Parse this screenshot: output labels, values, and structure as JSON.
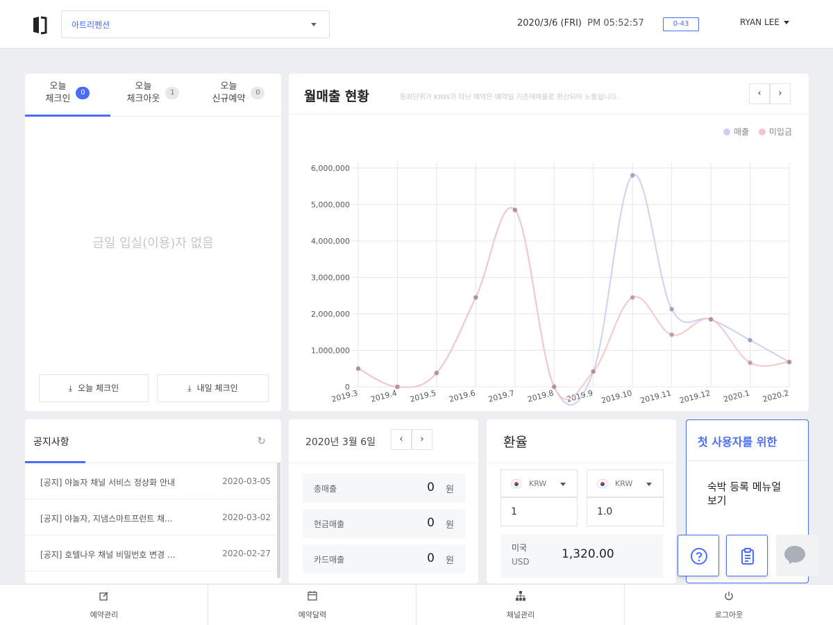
{
  "header": {
    "property_selected": "아트리펜션",
    "date": "2020/3/6 (FRI)",
    "time": "PM 05:52:57",
    "timer": "0-43",
    "user": "RYAN LEE"
  },
  "checkin": {
    "tabs": [
      {
        "line1": "오늘",
        "line2": "체크인",
        "count": "0"
      },
      {
        "line1": "오늘",
        "line2": "체크아웃",
        "count": "1"
      },
      {
        "line1": "오늘",
        "line2": "신규예약",
        "count": "0"
      }
    ],
    "empty_message": "금일 입실(이용)자 없음",
    "today_checkin_btn": "오늘 체크인",
    "tomorrow_checkin_btn": "내일 체크인"
  },
  "chart_card": {
    "title": "월매출 현황",
    "subtitle": "통화단위가 KRW가 아닌 예약은 예약일 기준매매율로 환산되어 노출됩니다.",
    "prev": "‹",
    "next": "›"
  },
  "chart_data": {
    "type": "line",
    "categories": [
      "2019.3",
      "2019.4",
      "2019.5",
      "2019.6",
      "2019.7",
      "2019.8",
      "2019.9",
      "2019.10",
      "2019.11",
      "2019.12",
      "2020.1",
      "2020.2"
    ],
    "series": [
      {
        "name": "매출",
        "color": "#c9cff5",
        "values": [
          500000,
          0,
          380000,
          2450000,
          4850000,
          0,
          420000,
          5800000,
          2130000,
          1850000,
          1280000,
          680000
        ]
      },
      {
        "name": "미입금",
        "color": "#f5c4c8",
        "values": [
          500000,
          0,
          380000,
          2450000,
          4850000,
          0,
          420000,
          2450000,
          1430000,
          1850000,
          660000,
          680000
        ]
      }
    ],
    "yticks": [
      "0",
      "1,000,000",
      "2,000,000",
      "3,000,000",
      "4,000,000",
      "5,000,000",
      "6,000,000"
    ],
    "ylim": [
      0,
      6000000
    ],
    "legend": "top-right"
  },
  "notice": {
    "title": "공지사항",
    "refresh_icon": "refresh-icon",
    "items": [
      {
        "title": "[공지] 야놀자 채널 서비스 정상화 안내",
        "date": "2020-03-05"
      },
      {
        "title": "[공지] 야놀자, 지냄스마트프런트 채...",
        "date": "2020-03-02"
      },
      {
        "title": "[공지] 호텔나우 채널 비밀번호 변경 ...",
        "date": "2020-02-27"
      }
    ]
  },
  "sales": {
    "date": "2020년 3월 6일",
    "prev": "‹",
    "next": "›",
    "rows": [
      {
        "label": "총매출",
        "value": "0",
        "unit": "원"
      },
      {
        "label": "현금매출",
        "value": "0",
        "unit": "원"
      },
      {
        "label": "카드매출",
        "value": "0",
        "unit": "원"
      }
    ]
  },
  "exchange": {
    "title": "환율",
    "from_code": "KRW",
    "to_code": "KRW",
    "from_amount": "1",
    "to_amount": "1.0",
    "usd_name": "미국",
    "usd_code": "USD",
    "usd_rate": "1,320.00"
  },
  "guide": {
    "title": "첫 사용자를 위한",
    "body": "숙박 등록 메뉴얼 보기"
  },
  "bottom_nav": [
    {
      "label": "예약관리",
      "icon": "edit-icon"
    },
    {
      "label": "예약달력",
      "icon": "calendar-icon"
    },
    {
      "label": "채널관리",
      "icon": "sitemap-icon"
    },
    {
      "label": "로그아웃",
      "icon": "power-icon"
    }
  ]
}
